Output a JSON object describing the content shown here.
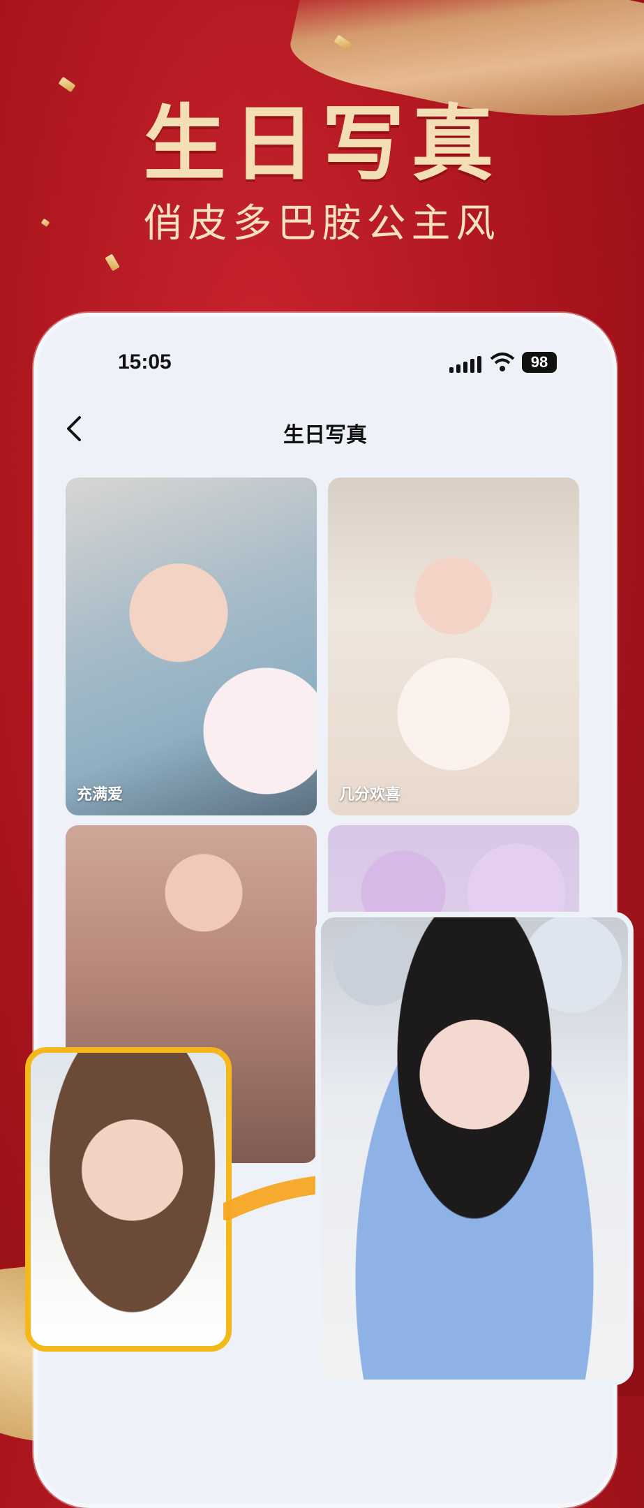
{
  "banner": {
    "title": "生日写真",
    "subtitle": "俏皮多巴胺公主风"
  },
  "status_bar": {
    "time": "15:05",
    "battery": "98"
  },
  "nav": {
    "title": "生日写真"
  },
  "cards": [
    {
      "label": "充满爱"
    },
    {
      "label": "几分欢喜"
    },
    {
      "label": ""
    },
    {
      "label": ""
    }
  ],
  "colors": {
    "background_red": "#a9141c",
    "gold": "#f4dfb4",
    "highlight_frame": "#f4b81a",
    "phone_background": "#eef2f8"
  },
  "icons": [
    "back-chevron-icon",
    "signal-icon",
    "wifi-icon",
    "battery-icon",
    "arrow-icon"
  ]
}
